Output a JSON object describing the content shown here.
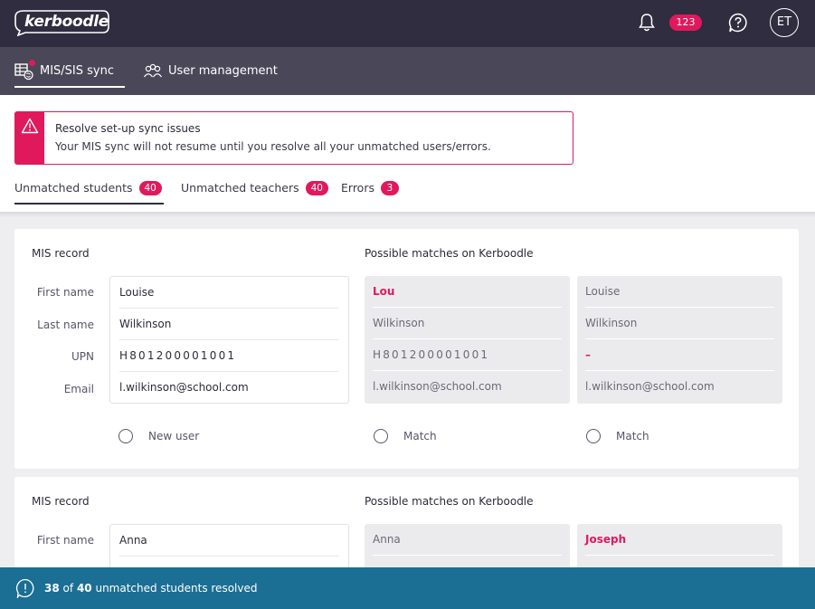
{
  "topbar": {
    "logo_text": "kerboodle",
    "notification_count": "123",
    "avatar_initials": "ET"
  },
  "nav": {
    "mis_sync": "MIS/SIS sync",
    "user_management": "User management"
  },
  "alert": {
    "title": "Resolve set-up sync issues",
    "message": "Your MIS sync will not resume until you resolve all your unmatched users/errors."
  },
  "tabs": [
    {
      "label": "Unmatched students",
      "count": "40"
    },
    {
      "label": "Unmatched teachers",
      "count": "40"
    },
    {
      "label": "Errors",
      "count": "3"
    }
  ],
  "labels": {
    "mis_record": "MIS record",
    "possible_matches": "Possible matches on Kerboodle",
    "first_name": "First name",
    "last_name": "Last name",
    "upn": "UPN",
    "email": "Email",
    "new_user": "New user",
    "match": "Match"
  },
  "records": [
    {
      "mis": {
        "first_name": "Louise",
        "last_name": "Wilkinson",
        "upn": "H801200001001",
        "email": "l.wilkinson@school.com"
      },
      "matches": [
        {
          "first_name": "Lou",
          "last_name": "Wilkinson",
          "upn": "H801200001001",
          "email": "l.wilkinson@school.com"
        },
        {
          "first_name": "Louise",
          "last_name": "Wilkinson",
          "upn": "–",
          "email": "l.wilkinson@school.com"
        }
      ]
    },
    {
      "mis": {
        "first_name": "Anna"
      },
      "matches": [
        {
          "first_name": "Anna"
        },
        {
          "first_name": "Joseph"
        }
      ]
    }
  ],
  "footer": {
    "resolved": "38",
    "of_text": "of",
    "total": "40",
    "suffix": "unmatched students resolved"
  },
  "colors": {
    "topbar": "#2f2d3f",
    "subnav": "#4a4858",
    "accent_pink": "#e0195c",
    "footer_blue": "#1b6e94"
  }
}
